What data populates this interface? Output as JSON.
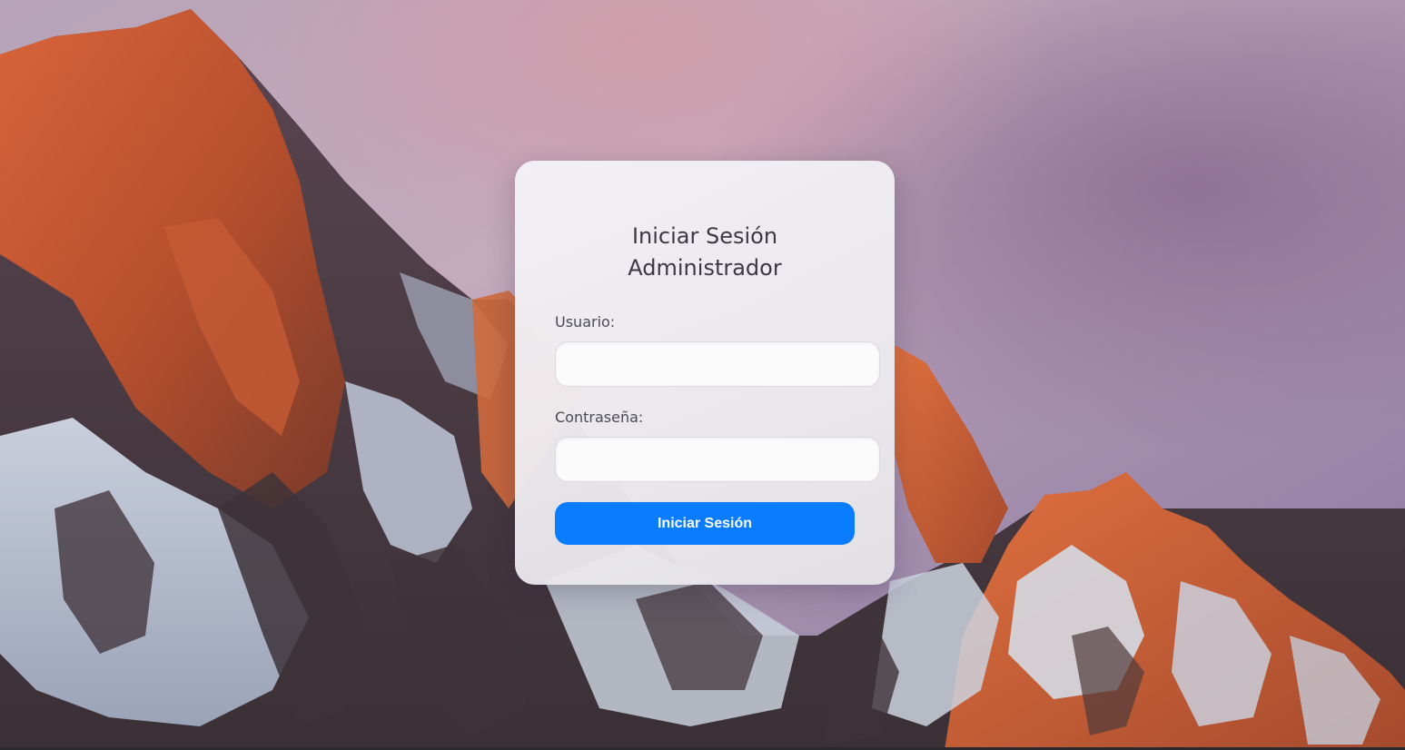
{
  "login": {
    "title_line1": "Iniciar Sesión",
    "title_line2": "Administrador",
    "username_label": "Usuario:",
    "username_value": "",
    "password_label": "Contraseña:",
    "password_value": "",
    "submit_label": "Iniciar Sesión"
  },
  "colors": {
    "accent": "#0a7cff",
    "card_bg": "#f1f0f3",
    "text": "#3a3a40"
  },
  "background": {
    "description_icon": "mountain-wallpaper"
  }
}
